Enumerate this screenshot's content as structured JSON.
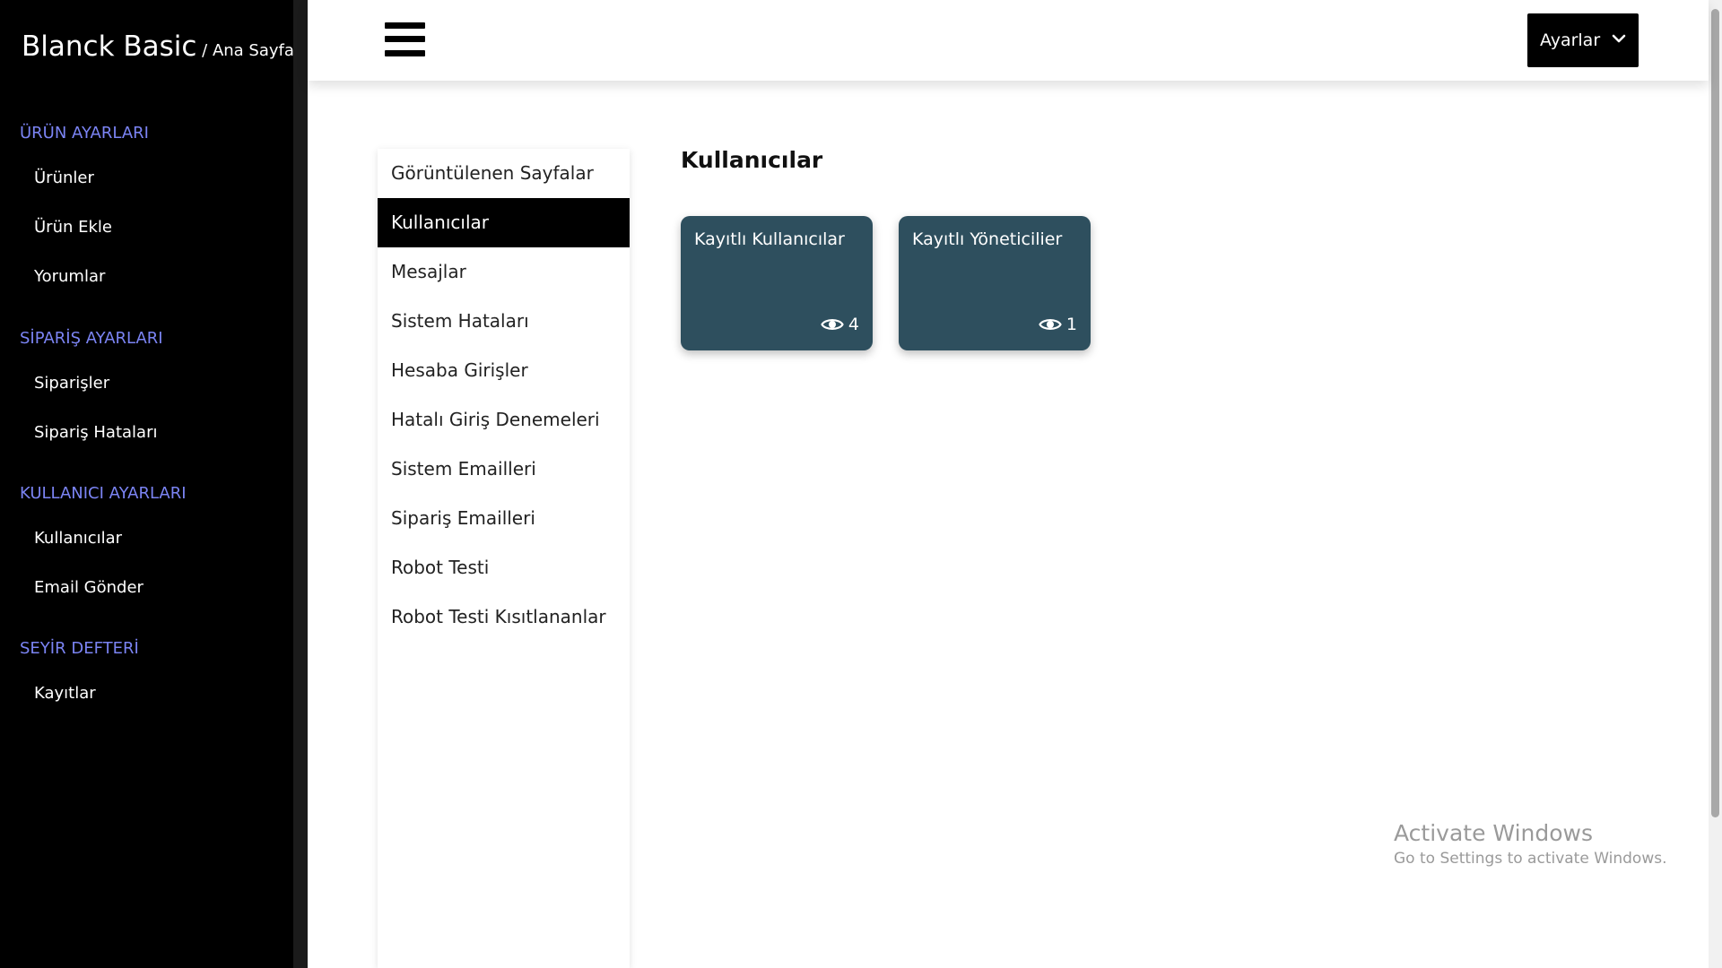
{
  "brand": {
    "title": "Blanck Basic",
    "crumb": " / Ana Sayfa"
  },
  "sidebar": {
    "sections": [
      {
        "title": "ÜRÜN AYARLARI",
        "items": [
          "Ürünler",
          "Ürün Ekle",
          "Yorumlar"
        ]
      },
      {
        "title": "SİPARİŞ AYARLARI",
        "items": [
          "Siparişler",
          "Sipariş Hataları"
        ]
      },
      {
        "title": "KULLANICI AYARLARI",
        "items": [
          "Kullanıcılar",
          "Email Gönder"
        ]
      },
      {
        "title": "SEYİR DEFTERİ",
        "items": [
          "Kayıtlar"
        ]
      }
    ],
    "section_color": "#7b84f4"
  },
  "header": {
    "menu_icon": "hamburger-menu-icon",
    "settings_label": "Ayarlar",
    "settings_icon": "chevron-down-icon"
  },
  "submenu": {
    "items": [
      "Görüntülenen Sayfalar",
      "Kullanıcılar",
      "Mesajlar",
      "Sistem Hataları",
      "Hesaba Girişler",
      "Hatalı Giriş Denemeleri",
      "Sistem Emailleri",
      "Sipariş Emailleri",
      "Robot Testi",
      "Robot Testi Kısıtlananlar"
    ],
    "active": "Kullanıcılar"
  },
  "main": {
    "title": "Kullanıcılar",
    "cards": [
      {
        "label": "Kayıtlı Kullanıcılar",
        "count": "4",
        "icon": "eye-icon"
      },
      {
        "label": "Kayıtlı Yöneticilier",
        "count": "1",
        "icon": "eye-icon"
      }
    ],
    "card_color": "#2e4f5e"
  },
  "watermark": {
    "title": "Activate Windows",
    "subtitle": "Go to Settings to activate Windows."
  }
}
